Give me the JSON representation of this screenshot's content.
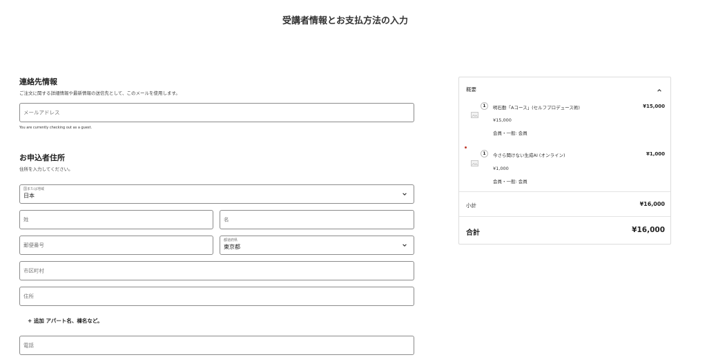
{
  "page": {
    "title": "受講者情報とお支払方法の入力"
  },
  "contact": {
    "heading": "連絡先情報",
    "subtext": "ご注文に関する詳細情報や最新情報の送信先として、このメールを使用します。",
    "email_placeholder": "メールアドレス",
    "guest_note": "You are currently checking out as a guest."
  },
  "address": {
    "heading": "お申込者住所",
    "subtext": "住所を入力してください。",
    "country_label": "国または地域",
    "country_value": "日本",
    "last_name_placeholder": "姓",
    "first_name_placeholder": "名",
    "postal_placeholder": "郵便番号",
    "prefecture_label": "都道府県",
    "prefecture_value": "東京都",
    "city_placeholder": "市区町村",
    "street_placeholder": "住所",
    "add_apartment_label": "+ 追加 アパート名、棟名など。",
    "phone_placeholder": "電話"
  },
  "summary": {
    "title": "概要",
    "items": [
      {
        "qty": "1",
        "name": "明石勤「Aコース」(セルフプロデュース術)",
        "price": "¥15,000",
        "unit_price": "¥15,000",
        "variant": "会員・一般: 会員"
      },
      {
        "qty": "1",
        "name": "今さら聞けない生成AI (オンライン)",
        "price": "¥1,000",
        "unit_price": "¥1,000",
        "variant": "会員・一般: 会員"
      }
    ],
    "subtotal_label": "小計",
    "subtotal_value": "¥16,000",
    "total_label": "合計",
    "total_value": "¥16,000"
  },
  "icons": {
    "chevron_down": "chevron-down-icon",
    "chevron_up": "chevron-up-icon",
    "image_placeholder": "image-placeholder-icon"
  },
  "colors": {
    "border": "#8a8a8a",
    "text": "#1f1f1f",
    "accent_dot": "#c0392b"
  }
}
